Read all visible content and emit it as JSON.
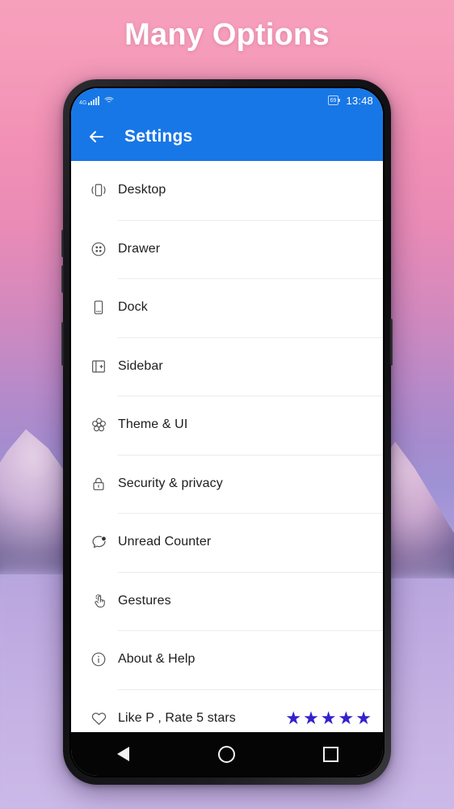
{
  "headline": "Many Options",
  "statusbar": {
    "network_label": "4G",
    "signal_icon": "signal-bars-icon",
    "wifi_icon": "wifi-icon",
    "battery_level": "69",
    "battery_icon": "battery-icon",
    "clock": "13:48"
  },
  "appbar": {
    "back_icon": "back-arrow-icon",
    "title": "Settings"
  },
  "list": {
    "items": [
      {
        "label": "Desktop",
        "icon": "desktop-icon"
      },
      {
        "label": "Drawer",
        "icon": "drawer-icon"
      },
      {
        "label": "Dock",
        "icon": "dock-icon"
      },
      {
        "label": "Sidebar",
        "icon": "sidebar-icon"
      },
      {
        "label": "Theme & UI",
        "icon": "theme-flower-icon"
      },
      {
        "label": "Security & privacy",
        "icon": "lock-icon"
      },
      {
        "label": "Unread Counter",
        "icon": "chat-bubble-badge-icon"
      },
      {
        "label": "Gestures",
        "icon": "hand-tap-icon"
      },
      {
        "label": "About & Help",
        "icon": "info-circle-icon"
      },
      {
        "label": "Like P , Rate 5 stars",
        "icon": "heart-icon",
        "stars": 5
      }
    ]
  },
  "navbar": {
    "back": "back-triangle-icon",
    "home": "home-circle-icon",
    "recents": "recents-square-icon"
  },
  "colors": {
    "appbar_blue": "#1877e6",
    "star_indigo": "#3322CC",
    "text_primary": "#1d1d1d"
  }
}
